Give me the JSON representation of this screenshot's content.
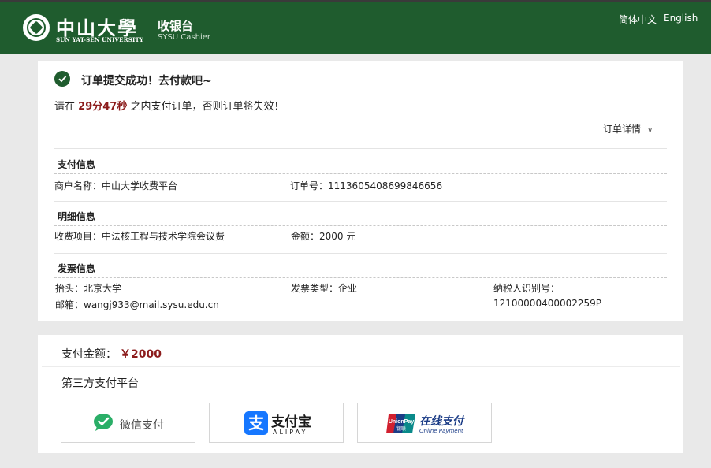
{
  "header": {
    "logo_cn": "中山大學",
    "logo_en": "SUN YAT-SEN UNIVERSITY",
    "cashier_title": "收银台",
    "cashier_subtitle": "SYSU Cashier",
    "lang_zh": "简体中文",
    "lang_en": "English"
  },
  "order": {
    "success_title": "订单提交成功！去付款吧~",
    "deadline_prefix": "请在",
    "deadline_time": "29分47秒",
    "deadline_suffix": "之内支付订单，否则订单将失效！",
    "detail_toggle": "订单详情"
  },
  "sections": {
    "payment_info": {
      "title": "支付信息",
      "merchant_label": "商户名称：",
      "merchant_value": "中山大学收费平台",
      "order_no_label": "订单号：",
      "order_no_value": "1113605408699846656"
    },
    "detail_info": {
      "title": "明细信息",
      "item_label": "收费项目：",
      "item_value": "中法核工程与技术学院会议费",
      "amount_label": "金额：",
      "amount_value": "2000 元"
    },
    "invoice_info": {
      "title": "发票信息",
      "header_label": "抬头：",
      "header_value": "北京大学",
      "type_label": "发票类型：",
      "type_value": "企业",
      "tax_id_label": "纳税人识别号：",
      "tax_id_value": "12100000400002259P",
      "email_label": "邮箱：",
      "email_value": "wangj933@mail.sysu.edu.cn"
    }
  },
  "payment": {
    "amount_label": "支付金额：",
    "amount_value": "￥2000",
    "third_party_title": "第三方支付平台",
    "wechat_label": "微信支付",
    "alipay_cn": "支付宝",
    "alipay_en": "ALIPAY",
    "alipay_icon_glyph": "支",
    "unionpay_cn": "在线支付",
    "unionpay_en": "Online Payment",
    "unionpay_logo_text": "UnionPay",
    "unionpay_logo_cn": "银联"
  },
  "colors": {
    "brand_green": "#1f5c2e",
    "accent_red": "#8c1c1c",
    "alipay_blue": "#1677ff",
    "wechat_green": "#2aae67",
    "unionpay_navy": "#1c3d87"
  }
}
